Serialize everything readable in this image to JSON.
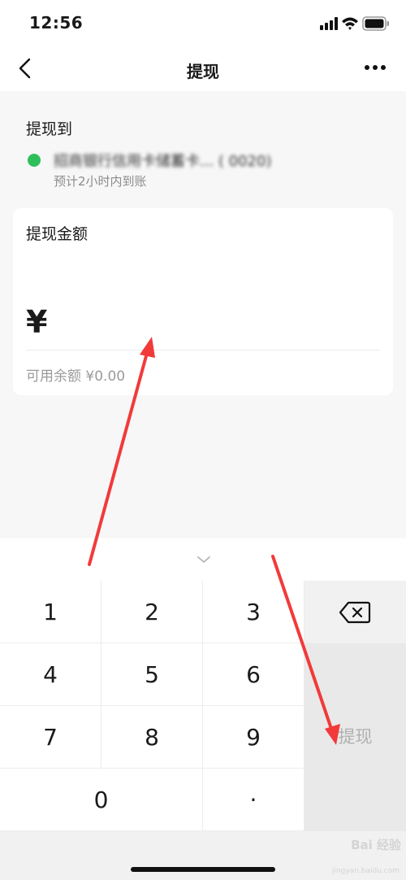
{
  "status_bar": {
    "time": "12:56"
  },
  "nav": {
    "title": "提现"
  },
  "destination": {
    "label": "提现到",
    "bank_name": "招商银行信用卡储蓄卡... (  0020)",
    "arrival_hint": "预计2小时内到账"
  },
  "amount_card": {
    "label": "提现金额",
    "currency": "¥",
    "input_value": "",
    "balance": "可用余额 ¥0.00"
  },
  "keyboard": {
    "keys": [
      "1",
      "2",
      "3",
      "4",
      "5",
      "6",
      "7",
      "8",
      "9",
      "0",
      "·"
    ],
    "withdraw_label": "提现"
  },
  "watermark": {
    "text": "Bai 经验",
    "sub": "jingyan.baidu.com"
  },
  "colors": {
    "accent_green": "#2fbf5a",
    "annotation_red": "#f23a3a"
  }
}
